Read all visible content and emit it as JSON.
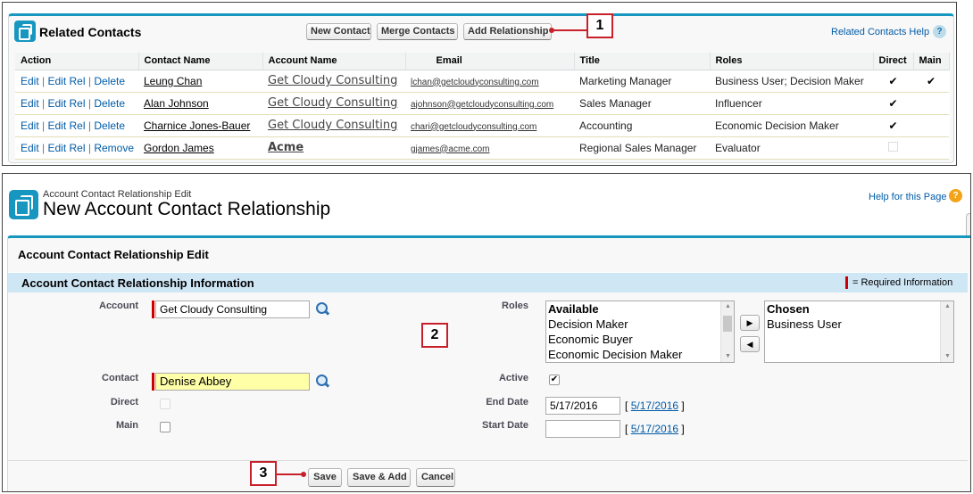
{
  "related_contacts": {
    "title": "Related Contacts",
    "buttons": {
      "new_contact": "New Contact",
      "merge_contacts": "Merge Contacts",
      "add_relationship": "Add Relationship"
    },
    "help_label": "Related Contacts Help",
    "help_icon": "?",
    "columns": [
      "Action",
      "Contact Name",
      "Account Name",
      "Email",
      "Title",
      "Roles",
      "Direct",
      "Main"
    ],
    "action_links": {
      "edit": "Edit",
      "edit_rel": "Edit Rel",
      "delete": "Delete",
      "remove": "Remove",
      "separator": "|"
    },
    "rows": [
      {
        "contact": "Leung Chan",
        "account": "Get Cloudy Consulting",
        "email": "lchan@getcloudyconsulting.com",
        "title": "Marketing Manager",
        "roles": "Business User; Decision Maker",
        "direct": "✔",
        "main": "✔"
      },
      {
        "contact": "Alan Johnson",
        "account": "Get Cloudy Consulting",
        "email": "ajohnson@getcloudyconsulting.com",
        "title": "Sales Manager",
        "roles": "Influencer",
        "direct": "✔",
        "main": ""
      },
      {
        "contact": "Charnice Jones-Bauer",
        "account": "Get Cloudy Consulting",
        "email": "chari@getcloudyconsulting.com",
        "title": "Accounting",
        "roles": "Economic Decision Maker",
        "direct": "✔",
        "main": ""
      },
      {
        "contact": "Gordon James",
        "account": "Acme",
        "email": "gjames@acme.com",
        "title": "Regional Sales Manager",
        "roles": "Evaluator",
        "direct": "",
        "main": ""
      }
    ]
  },
  "callouts": [
    "1",
    "2",
    "3"
  ],
  "edit_page": {
    "breadcrumb": "Account Contact Relationship Edit",
    "title": "New Account Contact Relationship",
    "help_label": "Help for this Page",
    "help_icon": "?",
    "section_title": "Account Contact Relationship Edit",
    "info_section_title": "Account Contact Relationship Information",
    "required_legend": "= Required Information",
    "fields": {
      "account": {
        "label": "Account",
        "value": "Get Cloudy Consulting"
      },
      "contact": {
        "label": "Contact",
        "value": "Denise Abbey"
      },
      "direct": {
        "label": "Direct"
      },
      "main": {
        "label": "Main"
      },
      "roles": {
        "label": "Roles"
      },
      "active": {
        "label": "Active",
        "checked": "✔"
      },
      "end_date": {
        "label": "End Date",
        "value": "5/17/2016",
        "today_link": "5/17/2016"
      },
      "start_date": {
        "label": "Start Date",
        "value": "",
        "today_link": "5/17/2016"
      }
    },
    "roles_available": {
      "header": "Available",
      "options": [
        "Decision Maker",
        "Economic Buyer",
        "Economic Decision Maker"
      ]
    },
    "roles_chosen": {
      "header": "Chosen",
      "options": [
        "Business User"
      ]
    },
    "move_right": "▶",
    "move_left": "◀",
    "bracket_open": "[",
    "bracket_close": "]",
    "buttons": {
      "save": "Save",
      "save_add": "Save & Add",
      "cancel": "Cancel"
    }
  },
  "colors": {
    "accent": "#1797c0",
    "callout": "#c8202a",
    "section": "#cfe6f5",
    "lookup_highlight": "#ffffa8"
  }
}
